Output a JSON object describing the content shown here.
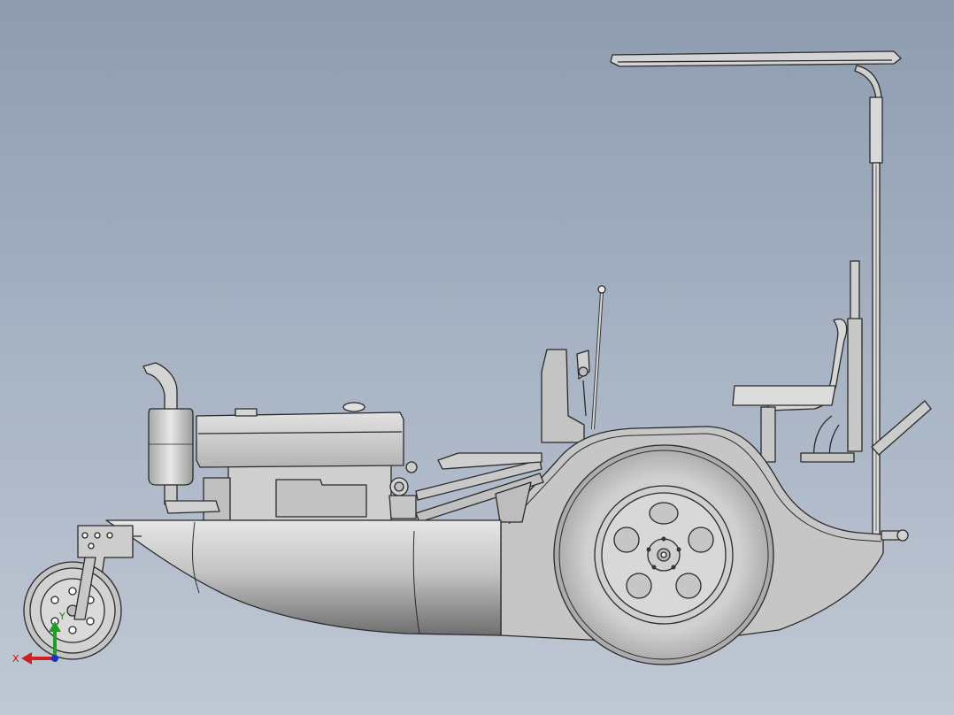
{
  "viewport": {
    "background_top": "#8e9cb0",
    "background_bottom": "#c0c8d4"
  },
  "model": {
    "body_color": "#c8c8c8",
    "shade_color": "#8a8a8a",
    "edge_color": "#2a2a2a"
  },
  "triad": {
    "x_label": "X",
    "y_label": "Y",
    "x_color": "#d02020",
    "y_color": "#20a020",
    "z_color": "#2030c0"
  }
}
